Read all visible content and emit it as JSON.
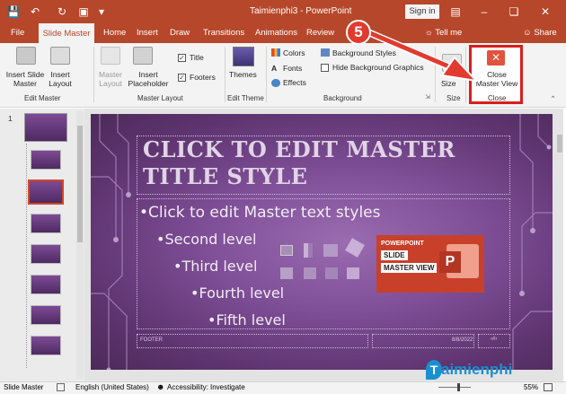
{
  "titlebar": {
    "title": "Taimienphi3  -  PowerPoint",
    "signin": "Sign in",
    "icons": [
      "save-icon",
      "undo-icon",
      "redo-icon",
      "presenter-icon",
      "customize-icon",
      "minimize-icon",
      "restore-icon",
      "close-icon"
    ]
  },
  "tabs": {
    "file": "File",
    "slide_master": "Slide Master",
    "home": "Home",
    "insert": "Insert",
    "draw": "Draw",
    "transitions": "Transitions",
    "animations": "Animations",
    "review": "Review",
    "tellme": "Tell me",
    "share": "Share"
  },
  "ribbon": {
    "insert_slide_master": "Insert Slide Master",
    "insert_layout": "Insert Layout",
    "group_edit_master": "Edit Master",
    "master_layout": "Master Layout",
    "insert_placeholder": "Insert Placeholder",
    "chk_title": "Title",
    "chk_footers": "Footers",
    "group_master_layout": "Master Layout",
    "themes": "Themes",
    "group_edit_theme": "Edit Theme",
    "colors": "Colors",
    "fonts": "Fonts",
    "effects": "Effects",
    "background_styles": "Background Styles",
    "hide_background": "Hide Background Graphics",
    "group_background": "Background",
    "size": "Size",
    "group_size": "Size",
    "close_master_view": "Close Master View",
    "group_close": "Close"
  },
  "annotation": {
    "step": "5"
  },
  "thumbnails": {
    "first_number": "1"
  },
  "slide": {
    "title": "CLICK TO EDIT MASTER TITLE STYLE",
    "levels": [
      "•Click to edit Master text styles",
      "•Second level",
      "•Third level",
      "•Fourth level",
      "•Fifth level"
    ],
    "footer": "FOOTER",
    "date": "8/8/2022",
    "badge_line1": "POWERPOINT",
    "badge_line2": "SLIDE",
    "badge_line3": "MASTER VIEW"
  },
  "status": {
    "view": "Slide Master",
    "language": "English (United States)",
    "accessibility": "Accessibility: Investigate",
    "zoom": "55%"
  },
  "watermark": {
    "text": "aimienphi"
  },
  "colors": {
    "accent": "#b7472a",
    "highlight": "#d81e1e",
    "slide_bg": "#7f4f98"
  }
}
